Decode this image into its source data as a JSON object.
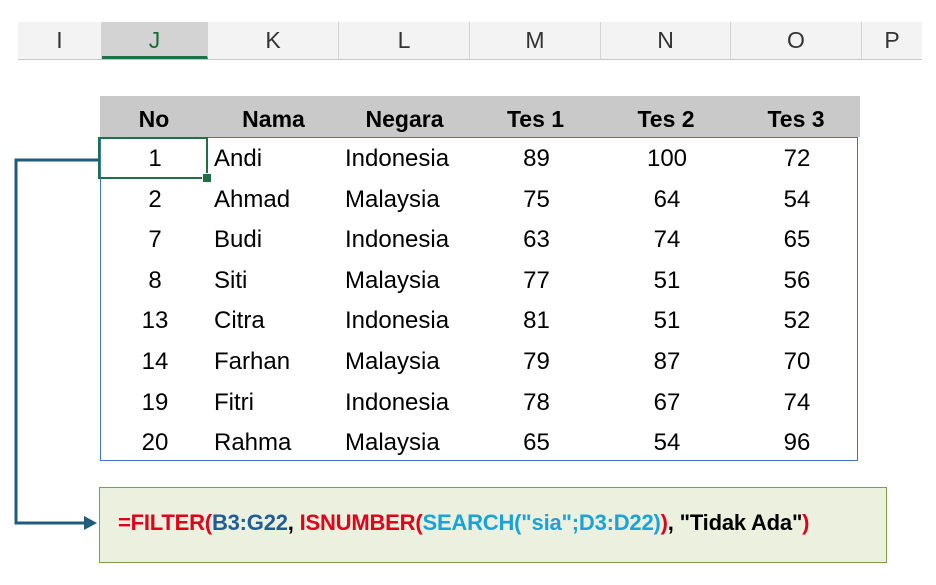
{
  "column_headers": [
    "I",
    "J",
    "K",
    "L",
    "M",
    "N",
    "O",
    "P"
  ],
  "selected_column": "J",
  "table": {
    "headers": [
      "No",
      "Nama",
      "Negara",
      "Tes 1",
      "Tes 2",
      "Tes 3"
    ],
    "rows": [
      [
        "1",
        "Andi",
        "Indonesia",
        "89",
        "100",
        "72"
      ],
      [
        "2",
        "Ahmad",
        "Malaysia",
        "75",
        "64",
        "54"
      ],
      [
        "7",
        "Budi",
        "Indonesia",
        "63",
        "74",
        "65"
      ],
      [
        "8",
        "Siti",
        "Malaysia",
        "77",
        "51",
        "56"
      ],
      [
        "13",
        "Citra",
        "Indonesia",
        "81",
        "51",
        "52"
      ],
      [
        "14",
        "Farhan",
        "Malaysia",
        "79",
        "87",
        "70"
      ],
      [
        "19",
        "Fitri",
        "Indonesia",
        "78",
        "67",
        "74"
      ],
      [
        "20",
        "Rahma",
        "Malaysia",
        "65",
        "54",
        "96"
      ]
    ]
  },
  "formula": {
    "parts": [
      {
        "text": "=FILTER(",
        "color": "red"
      },
      {
        "text": "B3:G22",
        "color": "blue"
      },
      {
        "text": ", ",
        "color": "black"
      },
      {
        "text": "ISNUMBER(",
        "color": "red"
      },
      {
        "text": "SEARCH(\"sia\";D3:D22)",
        "color": "cyan"
      },
      {
        "text": ")",
        "color": "red"
      },
      {
        "text": ", \"Tidak Ada\"",
        "color": "black"
      },
      {
        "text": ")",
        "color": "red"
      }
    ]
  },
  "colors": {
    "selection_green": "#1e7145",
    "table_border": "#4472c4",
    "arrow": "#1f5d7a",
    "formula_bg": "#ebf1de"
  }
}
